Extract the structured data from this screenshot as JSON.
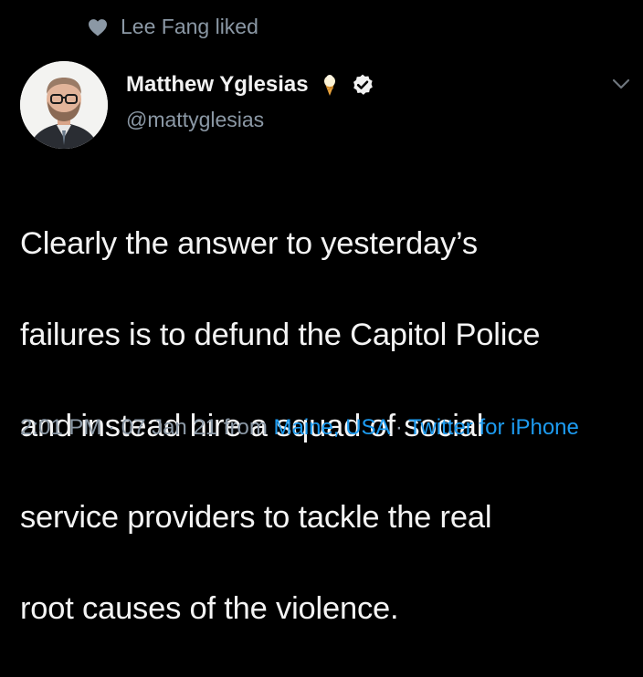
{
  "social_context": {
    "text": "Lee Fang liked",
    "icon": "heart-icon"
  },
  "author": {
    "display_name": "Matthew Yglesias",
    "handle": "@mattyglesias",
    "emoji_icon": "ice-cream-cone-icon",
    "verified": true
  },
  "tweet": {
    "text_lines": [
      "Clearly the answer to yesterday’s",
      "failures is to defund the Capitol Police",
      "and instead hire a squad of social",
      "service providers to tackle the real",
      "root causes of the violence."
    ]
  },
  "meta": {
    "time": "2:01 PM",
    "sep1": " · ",
    "date": "07 Jan 21",
    "from_label": " from ",
    "location": "Maine, USA",
    "sep2": " · ",
    "source": "Twitter for iPhone"
  },
  "colors": {
    "background": "#000000",
    "secondary_text": "#8b98a5",
    "link": "#1d9bf0"
  }
}
